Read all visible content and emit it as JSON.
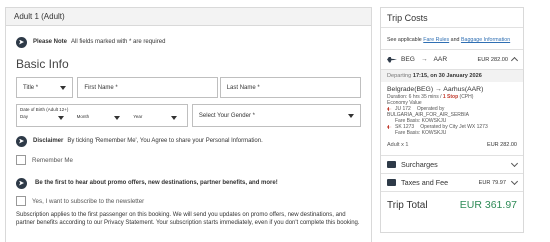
{
  "form": {
    "header": "Adult 1 (Adult)",
    "note_bold": "Please Note",
    "note_text": "All fields marked with * are required",
    "section_title": "Basic Info",
    "title_field": "Title *",
    "first_name_placeholder": "First Name *",
    "last_name_placeholder": "Last Name *",
    "dob_label": "Date of Birth (Adult 12+)",
    "dob_day": "Day",
    "dob_month": "Month",
    "dob_year": "Year",
    "gender_field": "Select Your Gender *",
    "disclaimer_bold": "Disclaimer",
    "disclaimer_text": "By ticking 'Remember Me', You Agree to share your Personal Information.",
    "remember_me": "Remember Me",
    "promo_heading": "Be the first to hear about promo offers, new destinations, partner benefits, and more!",
    "subscribe_label": "Yes, I want to subscribe to the newsletter",
    "subscription_text": "Subscription applies to the first passenger on this booking. We will send you updates on promo offers, new destinations, and partner benefits according to our Privacy Statement. Your subscription starts immediately, even if you don't complete this booking."
  },
  "costs": {
    "title": "Trip Costs",
    "links_prefix": "See applicable",
    "fare_rules_link": "Fare Rules",
    "links_and": "and",
    "baggage_link": "Baggage Information",
    "origin": "BEG",
    "destination": "AAR",
    "route_price": "EUR 282.00",
    "departing_label": "Departing",
    "departing_value": "17:15, on 30 January 2026",
    "from_city": "Belgrade(BEG)",
    "to_city": "Aarhus(AAR)",
    "duration": "Duration: 6 hrs 35 mins /",
    "stops": "1 Stop",
    "via": "(CPH)",
    "economy": "Economy Value",
    "segments": [
      {
        "flight": "JU 172",
        "operated": "Operated by",
        "carrier": "BULGARIA_AIR_FOR_AIR_SERBIA",
        "basis": "Fare Basis: KOWSKJU"
      },
      {
        "flight": "SK 1273",
        "operated": "Operated by City Jet WX 1273",
        "carrier": "",
        "basis": "Fare Basis: KOWSKJU"
      }
    ],
    "adult_label": "Adult x 1",
    "adult_price": "EUR 282.00",
    "surcharges_label": "Surcharges",
    "taxes_label": "Taxes and Fee",
    "taxes_value": "EUR 79.97",
    "total_label": "Trip Total",
    "total_value": "EUR 361.97"
  }
}
